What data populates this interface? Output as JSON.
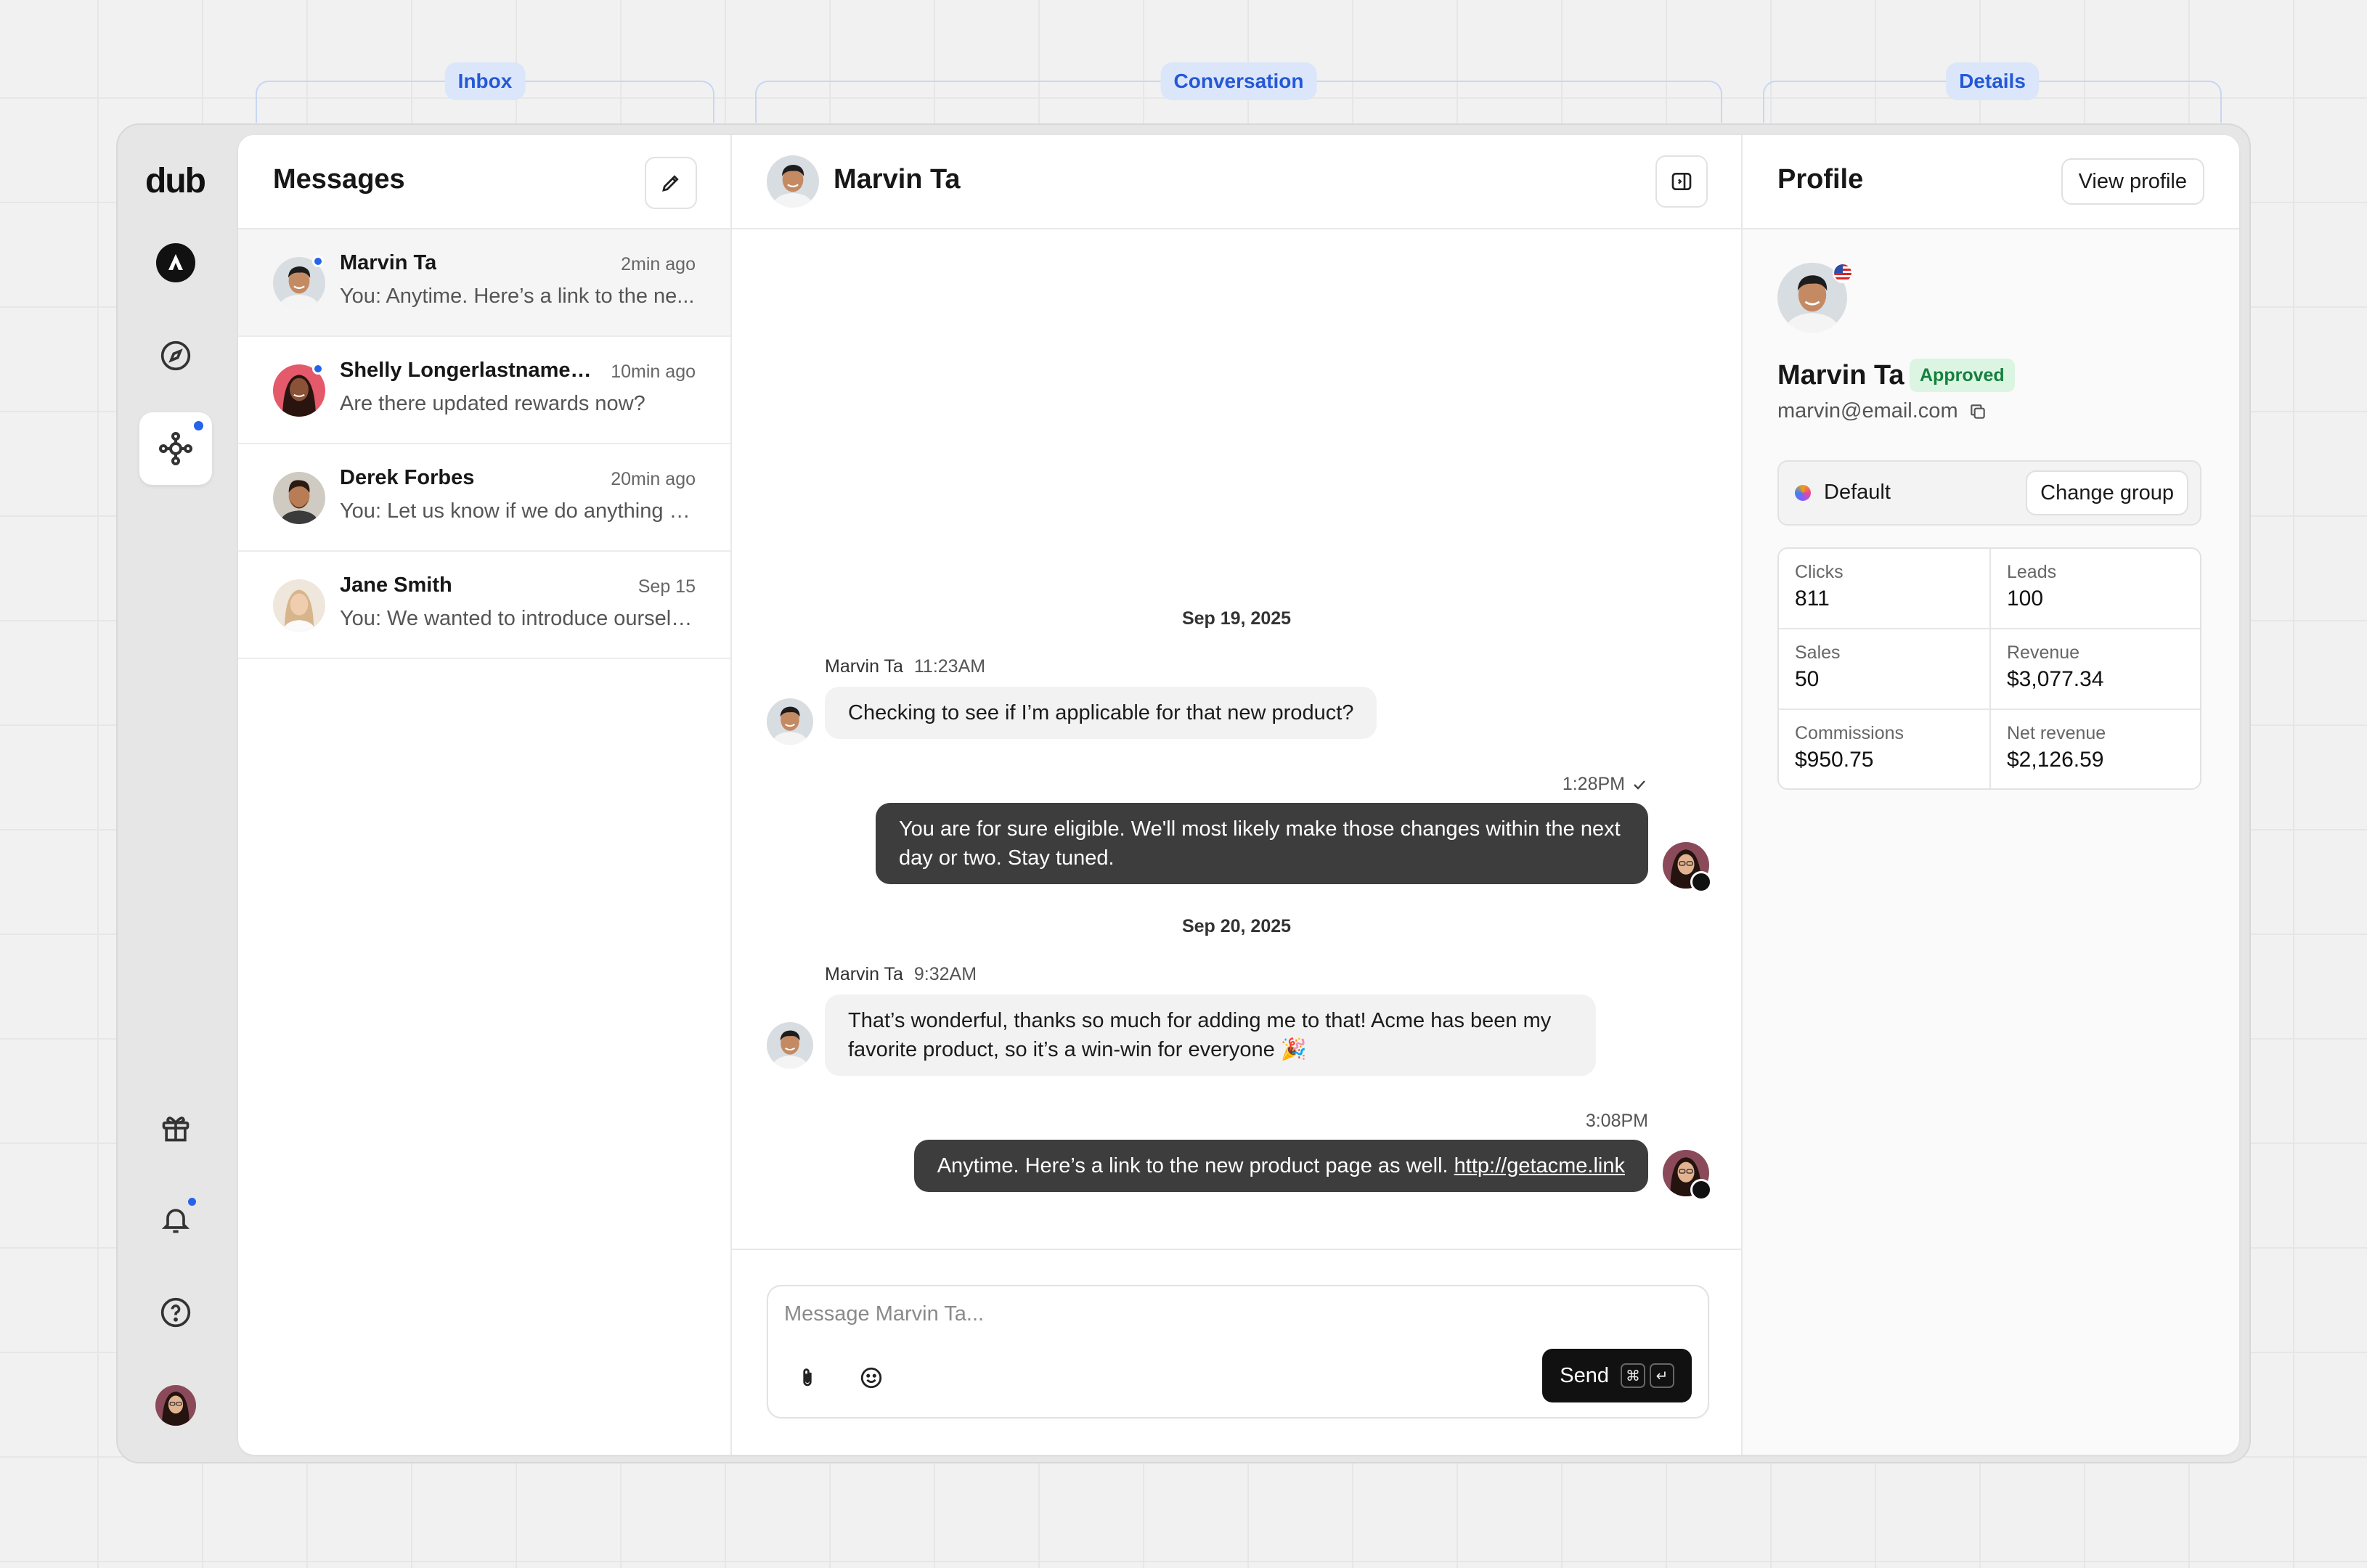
{
  "markers": {
    "inbox": "Inbox",
    "conversation": "Conversation",
    "details": "Details"
  },
  "sidebar": {
    "logo": "dub",
    "items": [
      {
        "icon": "brand-a-icon"
      },
      {
        "icon": "compass-icon"
      },
      {
        "icon": "network-icon",
        "active": true
      },
      {
        "icon": "gift-icon"
      },
      {
        "icon": "bell-icon"
      },
      {
        "icon": "help-icon"
      },
      {
        "icon": "user-avatar"
      }
    ]
  },
  "inbox": {
    "title": "Messages",
    "conversations": [
      {
        "name": "Marvin Ta",
        "time": "2min ago",
        "preview": "You: Anytime. Here’s a link to the ne...",
        "unread": true,
        "active": true
      },
      {
        "name": "Shelly Longerlastnamelik...",
        "time": "10min ago",
        "preview": "Are there updated rewards now?",
        "unread": true
      },
      {
        "name": "Derek Forbes",
        "time": "20min ago",
        "preview": "You: Let us know if we do anything e..."
      },
      {
        "name": "Jane Smith",
        "time": "Sep 15",
        "preview": "You: We wanted to introduce ourselv..."
      }
    ]
  },
  "conversation": {
    "contact": "Marvin Ta",
    "dates": [
      "Sep 19, 2025",
      "Sep 20, 2025"
    ],
    "messages": [
      {
        "sender": "Marvin Ta",
        "time": "11:23AM",
        "text": "Checking to see if I’m applicable for that new product?"
      },
      {
        "time": "1:28PM",
        "text": "You are for sure eligible. We'll most likely make those changes within the next day or two. Stay tuned."
      },
      {
        "sender": "Marvin Ta",
        "time": "9:32AM",
        "text": "That’s wonderful, thanks so much for adding me to that! Acme has been my favorite product, so it’s a win-win for everyone 🎉"
      },
      {
        "time": "3:08PM",
        "text": "Anytime. Here’s a link to the new product page as well. ",
        "link": "http://getacme.link"
      }
    ],
    "composer": {
      "placeholder": "Message Marvin Ta...",
      "send_label": "Send",
      "shortcut_cmd": "⌘",
      "shortcut_enter": "↵"
    }
  },
  "details": {
    "title": "Profile",
    "view_profile": "View profile",
    "name": "Marvin Ta",
    "status": "Approved",
    "email": "marvin@email.com",
    "group": "Default",
    "change_group": "Change group",
    "stats": [
      {
        "label": "Clicks",
        "value": "811"
      },
      {
        "label": "Leads",
        "value": "100"
      },
      {
        "label": "Sales",
        "value": "50"
      },
      {
        "label": "Revenue",
        "value": "$3,077.34"
      },
      {
        "label": "Commissions",
        "value": "$950.75"
      },
      {
        "label": "Net revenue",
        "value": "$2,126.59"
      }
    ]
  },
  "colors": {
    "accent": "#2563eb",
    "approved_bg": "#dcf5e3",
    "approved_text": "#15803d",
    "outgoing_bubble": "#3d3d3d"
  }
}
